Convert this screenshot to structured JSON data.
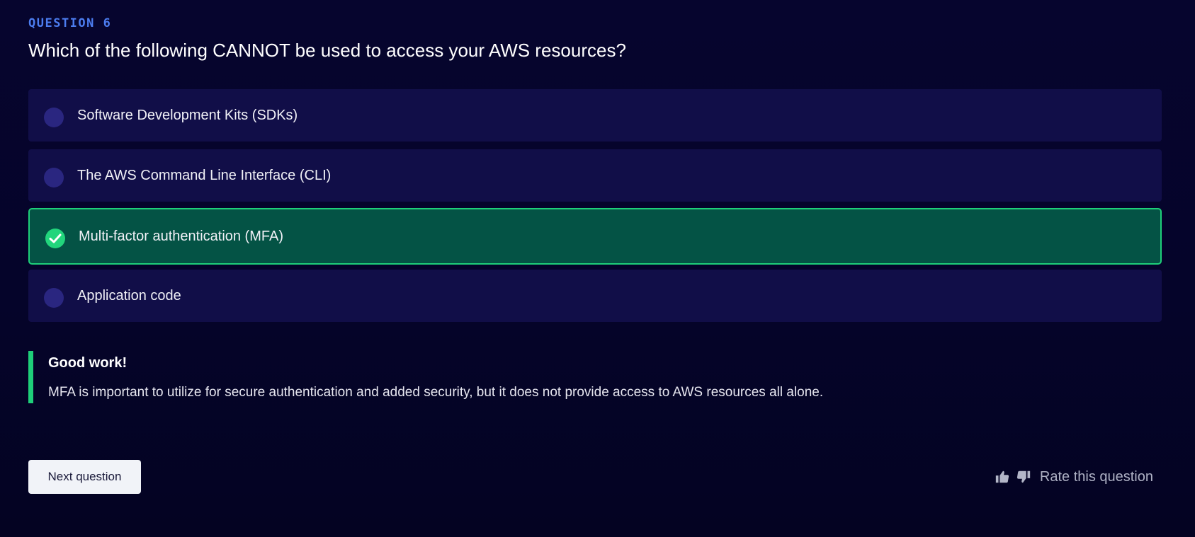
{
  "question": {
    "label": "QUESTION 6",
    "text": "Which of the following CANNOT be used to access your AWS resources?"
  },
  "options": [
    {
      "label": "Software Development Kits (SDKs)",
      "selected": false
    },
    {
      "label": "The AWS Command Line Interface (CLI)",
      "selected": false
    },
    {
      "label": "Multi-factor authentication (MFA)",
      "selected": true
    },
    {
      "label": "Application code",
      "selected": false
    }
  ],
  "feedback": {
    "title": "Good work!",
    "text": "MFA is important to utilize for secure authentication and added security, but it does not provide access to AWS resources all alone."
  },
  "actions": {
    "next_label": "Next question",
    "rate_label": "Rate this question",
    "thumbs_up_icon": "thumbs-up-icon",
    "thumbs_down_icon": "thumbs-down-icon"
  },
  "colors": {
    "background": "#06052b",
    "accent_blue": "#4c7df0",
    "option_bg": "#110e48",
    "correct_bg": "#045345",
    "correct_border": "#1ecf79"
  }
}
